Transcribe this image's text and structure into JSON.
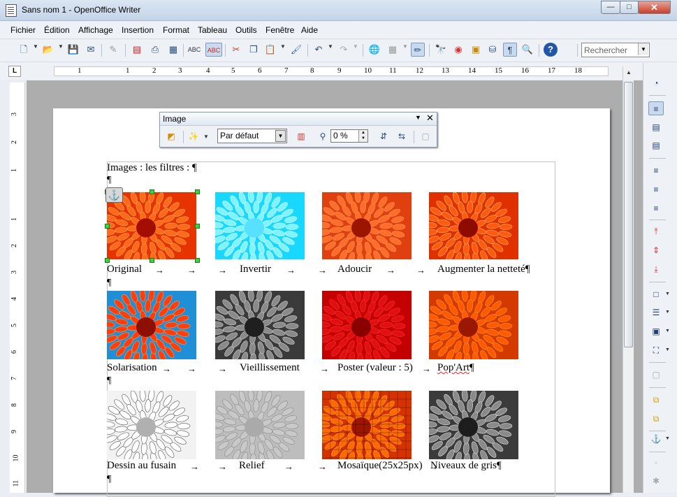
{
  "window": {
    "title": "Sans nom 1 - OpenOffice Writer",
    "minimize_label": "—",
    "maximize_label": "□",
    "close_label": "✕"
  },
  "menus": [
    {
      "label": "Fichier"
    },
    {
      "label": "Édition"
    },
    {
      "label": "Affichage"
    },
    {
      "label": "Insertion"
    },
    {
      "label": "Format"
    },
    {
      "label": "Tableau"
    },
    {
      "label": "Outils"
    },
    {
      "label": "Fenêtre"
    },
    {
      "label": "Aide"
    }
  ],
  "toolbar": {
    "search_placeholder": "Rechercher",
    "icons": [
      "new-document-icon",
      "open-folder-icon",
      "save-icon",
      "email-icon",
      "edit-file-icon",
      "export-pdf-icon",
      "print-icon",
      "print-preview-icon",
      "spellcheck-icon",
      "autospellcheck-icon",
      "cut-icon",
      "copy-icon",
      "paste-icon",
      "clone-format-icon",
      "undo-icon",
      "redo-icon",
      "hyperlink-icon",
      "table-icon",
      "draw-functions-icon",
      "find-replace-icon",
      "navigator-icon",
      "gallery-icon",
      "data-sources-icon",
      "formatting-marks-icon",
      "zoom-icon",
      "help-icon"
    ]
  },
  "ruler": {
    "corner_label": "L",
    "h_numbers": [
      "1",
      "1",
      "2",
      "3",
      "4",
      "5",
      "6",
      "7",
      "8",
      "9",
      "10",
      "11",
      "12",
      "13",
      "14",
      "15",
      "16",
      "17",
      "18"
    ],
    "v_numbers": [
      "3",
      "2",
      "1",
      "1",
      "2",
      "3",
      "4",
      "5",
      "6",
      "7",
      "8",
      "9",
      "10",
      "11"
    ]
  },
  "image_toolbar": {
    "title": "Image",
    "filter_value": "Par défaut",
    "transparency_value": "0 %"
  },
  "document": {
    "heading": "Images : les filtres : ¶",
    "pilcrow": "¶",
    "arrow": "→",
    "rows": [
      {
        "captions": [
          "Original",
          "Invertir",
          "Adoucir",
          "Augmenter la netteté¶"
        ],
        "filters": [
          "original",
          "invert",
          "soften",
          "sharpen"
        ]
      },
      {
        "captions": [
          "Solarisation",
          "Vieillissement",
          "Poster (valeur : 5)",
          "Pop'Art¶"
        ],
        "filters": [
          "solarize",
          "aging",
          "poster",
          "popart"
        ]
      },
      {
        "captions": [
          "Dessin au fusain",
          "Relief",
          "Mosaïque(25x25px)",
          "Niveaux de gris¶"
        ],
        "filters": [
          "charcoal",
          "relief",
          "mosaic",
          "grayscale"
        ]
      }
    ]
  }
}
